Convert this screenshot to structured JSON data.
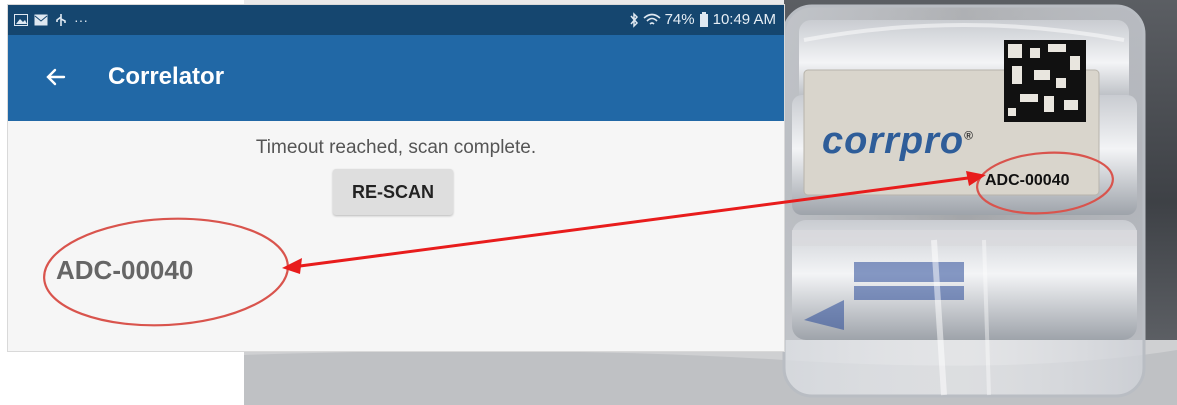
{
  "status_bar": {
    "left_icons": [
      "image-icon",
      "mail-icon",
      "usb-icon",
      "more-icon"
    ],
    "more": "···",
    "battery": "74%",
    "time": "10:49 AM"
  },
  "toolbar": {
    "title": "Correlator",
    "back_icon": "arrow-left-icon",
    "bg_color": "#2168a6"
  },
  "main": {
    "message": "Timeout reached, scan complete.",
    "rescan_label": "RE-SCAN",
    "device_id": "ADC-00040"
  },
  "photo": {
    "brand": "corrpro",
    "brand_mark": "®",
    "label_id": "ADC-00040"
  },
  "annotation": {
    "circle_color": "#d9544d",
    "arrow_color": "#e81c1c"
  }
}
